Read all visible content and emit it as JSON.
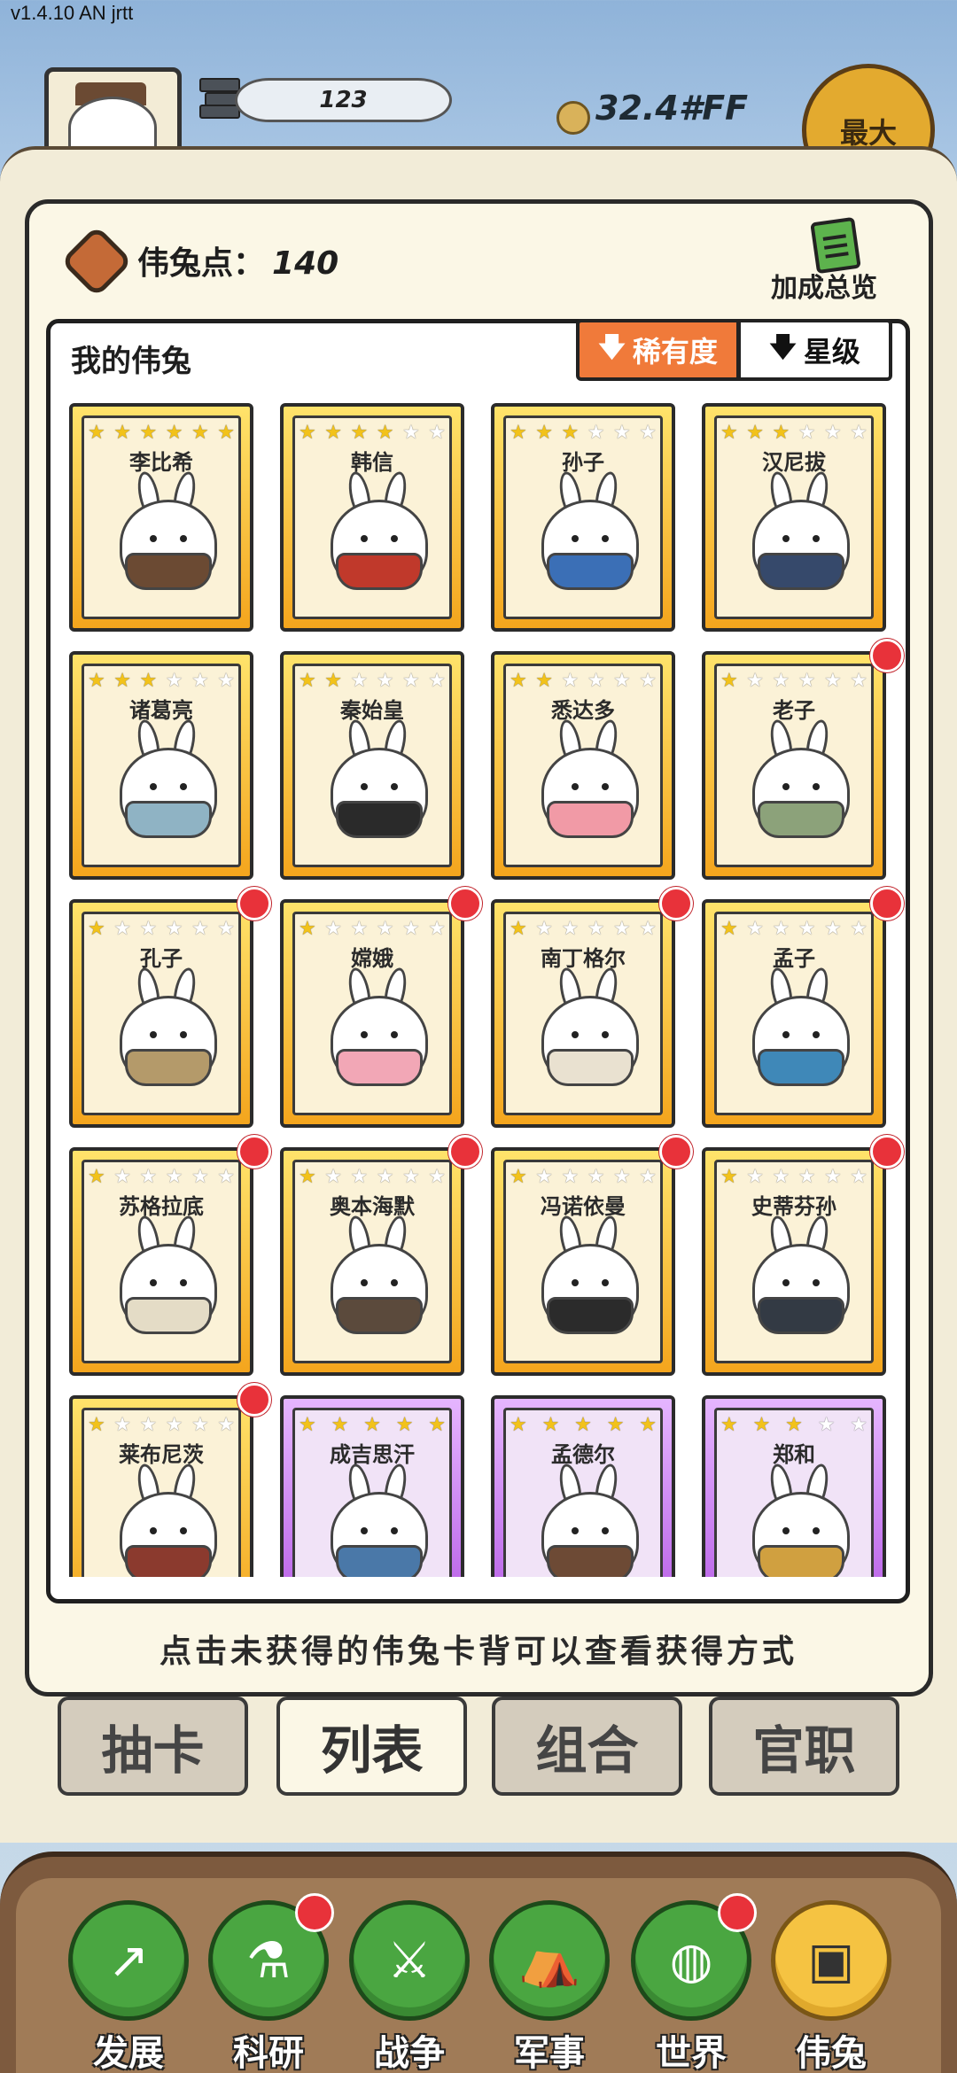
{
  "version": "v1.4.10 AN jrtt",
  "topbar": {
    "level_value": "123",
    "coins": "32.4#FF",
    "max_label": "最大"
  },
  "points": {
    "label": "伟兔点：",
    "value": "140"
  },
  "bonus_label": "加成总览",
  "collection": {
    "title": "我的伟兔",
    "sort_rarity": "稀有度",
    "sort_star": "星级"
  },
  "cards": [
    {
      "name": "李比希",
      "stars": 6,
      "filled": 6,
      "rarity": "gold",
      "badge": false,
      "cloth": "#6b4a33"
    },
    {
      "name": "韩信",
      "stars": 6,
      "filled": 4,
      "rarity": "gold",
      "badge": false,
      "cloth": "#c0392b"
    },
    {
      "name": "孙子",
      "stars": 6,
      "filled": 3,
      "rarity": "gold",
      "badge": false,
      "cloth": "#3b6fb6"
    },
    {
      "name": "汉尼拔",
      "stars": 6,
      "filled": 3,
      "rarity": "gold",
      "badge": false,
      "cloth": "#36496b"
    },
    {
      "name": "诸葛亮",
      "stars": 6,
      "filled": 3,
      "rarity": "gold",
      "badge": false,
      "cloth": "#8fb3c4"
    },
    {
      "name": "秦始皇",
      "stars": 6,
      "filled": 2,
      "rarity": "gold",
      "badge": false,
      "cloth": "#2a2a2a"
    },
    {
      "name": "悉达多",
      "stars": 6,
      "filled": 2,
      "rarity": "gold",
      "badge": false,
      "cloth": "#f19aa6"
    },
    {
      "name": "老子",
      "stars": 6,
      "filled": 1,
      "rarity": "gold",
      "badge": true,
      "cloth": "#8ca27a"
    },
    {
      "name": "孔子",
      "stars": 6,
      "filled": 1,
      "rarity": "gold",
      "badge": true,
      "cloth": "#b49a6a"
    },
    {
      "name": "嫦娥",
      "stars": 6,
      "filled": 1,
      "rarity": "gold",
      "badge": true,
      "cloth": "#f2a7b6"
    },
    {
      "name": "南丁格尔",
      "stars": 6,
      "filled": 1,
      "rarity": "gold",
      "badge": true,
      "cloth": "#e9e1d0"
    },
    {
      "name": "孟子",
      "stars": 6,
      "filled": 1,
      "rarity": "gold",
      "badge": true,
      "cloth": "#3f88b8"
    },
    {
      "name": "苏格拉底",
      "stars": 6,
      "filled": 1,
      "rarity": "gold",
      "badge": true,
      "cloth": "#e4dcc6"
    },
    {
      "name": "奥本海默",
      "stars": 6,
      "filled": 1,
      "rarity": "gold",
      "badge": true,
      "cloth": "#5b4a3c"
    },
    {
      "name": "冯诺依曼",
      "stars": 6,
      "filled": 1,
      "rarity": "gold",
      "badge": true,
      "cloth": "#2b2b2b"
    },
    {
      "name": "史蒂芬孙",
      "stars": 6,
      "filled": 1,
      "rarity": "gold",
      "badge": true,
      "cloth": "#333a44"
    },
    {
      "name": "莱布尼茨",
      "stars": 6,
      "filled": 1,
      "rarity": "gold",
      "badge": true,
      "cloth": "#8b3a2e"
    },
    {
      "name": "成吉思汗",
      "stars": 5,
      "filled": 5,
      "rarity": "purple",
      "badge": false,
      "cloth": "#4a78a8"
    },
    {
      "name": "孟德尔",
      "stars": 5,
      "filled": 5,
      "rarity": "purple",
      "badge": false,
      "cloth": "#6d4a35"
    },
    {
      "name": "郑和",
      "stars": 5,
      "filled": 3,
      "rarity": "purple",
      "badge": false,
      "cloth": "#d0a040"
    }
  ],
  "hint": "点击未获得的伟兔卡背可以查看获得方式",
  "tabs": [
    "抽卡",
    "列表",
    "组合",
    "官职"
  ],
  "active_tab": 1,
  "nav": [
    {
      "label": "发展",
      "icon": "arrow-up-icon",
      "glyph": "↗",
      "badge": false
    },
    {
      "label": "科研",
      "icon": "flask-icon",
      "glyph": "⚗",
      "badge": true
    },
    {
      "label": "战争",
      "icon": "swords-icon",
      "glyph": "⚔",
      "badge": false
    },
    {
      "label": "军事",
      "icon": "tent-icon",
      "glyph": "⛺",
      "badge": false
    },
    {
      "label": "世界",
      "icon": "globe-icon",
      "glyph": "◍",
      "badge": true
    },
    {
      "label": "伟兔",
      "icon": "bunny-card-icon",
      "glyph": "▣",
      "badge": false
    }
  ],
  "active_nav": 5
}
